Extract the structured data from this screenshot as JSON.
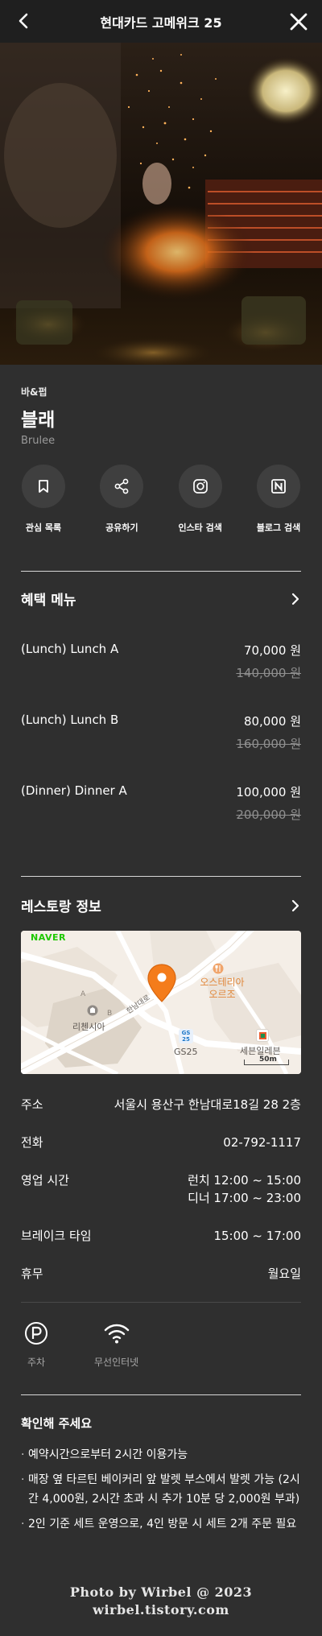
{
  "header": {
    "title": "현대카드 고메위크 25"
  },
  "restaurant": {
    "category": "바&펍",
    "name": "블래",
    "english_name": "Brulee"
  },
  "actions": [
    {
      "label": "관심 목록",
      "icon": "bookmark-icon"
    },
    {
      "label": "공유하기",
      "icon": "share-icon"
    },
    {
      "label": "인스타 검색",
      "icon": "instagram-icon"
    },
    {
      "label": "블로그 검색",
      "icon": "naver-blog-icon"
    }
  ],
  "benefit_menu": {
    "title": "혜택 메뉴",
    "items": [
      {
        "name": "(Lunch)  Lunch A",
        "price": "70,000 원",
        "original_price": "140,000 원"
      },
      {
        "name": "(Lunch)  Lunch B",
        "price": "80,000 원",
        "original_price": "160,000 원"
      },
      {
        "name": "(Dinner)  Dinner A",
        "price": "100,000 원",
        "original_price": "200,000 원"
      }
    ]
  },
  "restaurant_info": {
    "title": "레스토랑 정보",
    "map": {
      "provider": "NAVER",
      "poi_label": "오스테리아\n오르조",
      "poi_line1": "오스테리아",
      "poi_line2": "오르조",
      "left_label": "리첸시아",
      "road_label": "한남대로",
      "store_label": "GS25",
      "store_badge": "GS\n25",
      "store2_label": "세븐일레븐",
      "scale": "50m",
      "marker_a": "A",
      "marker_b": "B"
    },
    "rows": {
      "address_label": "주소",
      "address": "서울시 용산구 한남대로18길 28 2층",
      "phone_label": "전화",
      "phone": "02-792-1117",
      "hours_label": "영업 시간",
      "hours_lunch": "런치 12:00 ~ 15:00",
      "hours_dinner": "디너 17:00 ~ 23:00",
      "break_label": "브레이크 타임",
      "break_time": "15:00 ~ 17:00",
      "closed_label": "휴무",
      "closed": "월요일"
    }
  },
  "amenities": [
    {
      "label": "주차",
      "icon": "parking-icon"
    },
    {
      "label": "무선인터넷",
      "icon": "wifi-icon"
    }
  ],
  "confirm": {
    "title": "확인해 주세요",
    "notes": [
      "예약시간으로부터 2시간 이용가능",
      "매장 옆 타르틴 베이커리 앞 발렛 부스에서 발렛 가능 (2시간 4,000원, 2시간 초과 시 추가 10분 당 2,000원 부과)",
      "2인 기준 세트 운영으로, 4인 방문 시 세트 2개 주문 필요"
    ]
  },
  "watermark": {
    "line1": "Photo by Wirbel @ 2023",
    "line2": "wirbel.tistory.com"
  },
  "colors": {
    "background": "#2f2f2f",
    "header": "#1f1f1f",
    "marker": "#f47c1b",
    "divider": "#d7d7d7"
  }
}
